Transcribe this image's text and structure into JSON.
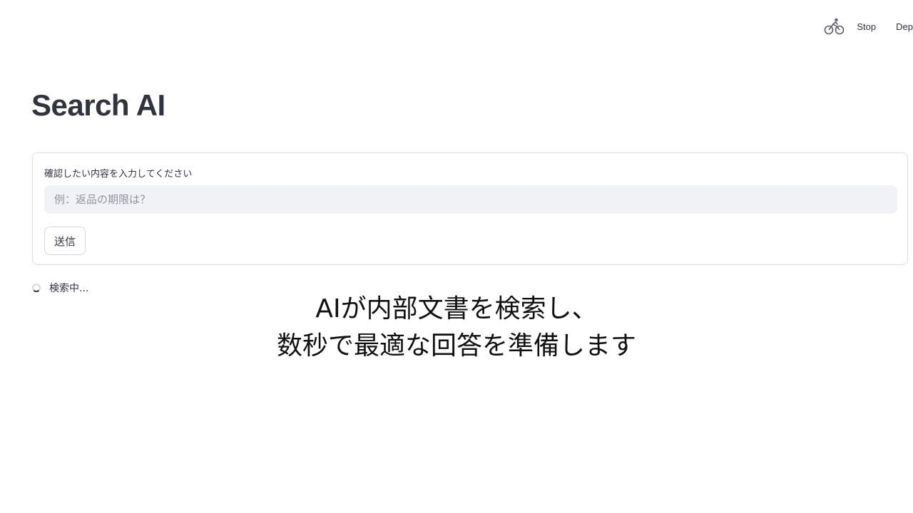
{
  "toolbar": {
    "running_icon": "running-cyclist-icon",
    "stop_label": "Stop",
    "deploy_label": "Dep"
  },
  "page": {
    "title": "Search AI"
  },
  "form": {
    "label": "確認したい内容を入力してください",
    "input_value": "",
    "input_placeholder": "例：返品の期限は？",
    "submit_label": "送信"
  },
  "status": {
    "text": "検索中...",
    "icon": "spinner-icon"
  },
  "caption": {
    "line1": "AIが内部文書を検索し、",
    "line2": "数秒で最適な回答を準備します"
  },
  "colors": {
    "text": "#31333f",
    "input_bg": "#f0f2f6",
    "border": "#dcdde3"
  }
}
